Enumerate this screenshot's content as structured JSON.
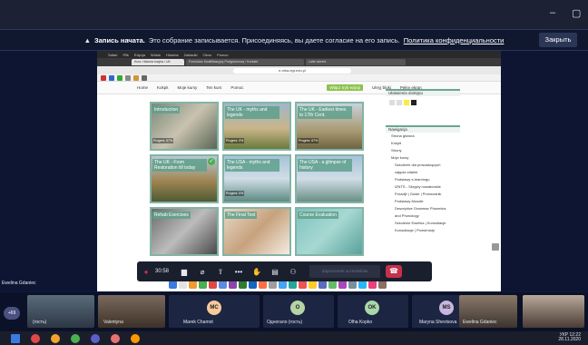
{
  "window": {
    "minimize": "–",
    "maximize": "▢"
  },
  "recording_banner": {
    "title": "Запись начата.",
    "message": "Это собрание записывается. Присоединяясь, вы даете согласие на его запись.",
    "policy_link": "Политика конфиденциальности",
    "close_label": "Закрыть"
  },
  "browser": {
    "app_menu": [
      "Safari",
      "Plik",
      "Edycja",
      "Widok",
      "Historia",
      "Zakładki",
      "Okno",
      "Pomoc"
    ],
    "tabs": [
      "Kurs: Historia krajów / UK",
      "Formularz Kwalifikacyjny Podyplomowy / Kontakt",
      "Latte aiorenl"
    ],
    "address": "e-mka.egt.edu.pl"
  },
  "site_nav": {
    "items": [
      "Home",
      "Kokpit",
      "Moje kursy",
      "Ten kurs",
      "Pomoc"
    ],
    "highlight": "Włącz tryb edycji",
    "other": [
      "Ukryj bloki",
      "Pełny ekran"
    ]
  },
  "tiles": [
    {
      "label": "Introduction",
      "progress": "Progres: 67%"
    },
    {
      "label": "The UK - myths and legends",
      "progress": "Progres: 0%"
    },
    {
      "label": "The UK - Earliest times to 17th Cent.",
      "progress": "Progres: 67%"
    },
    {
      "label": "The UK - From Restoration till today",
      "progress": ""
    },
    {
      "label": "The USA - myths and legends",
      "progress": "Progres: 0%"
    },
    {
      "label": "The USA - a glimpse of history",
      "progress": ""
    },
    {
      "label": "Rehab Exercises",
      "progress": ""
    },
    {
      "label": "The Final Test",
      "progress": ""
    },
    {
      "label": "Course Evaluation",
      "progress": ""
    }
  ],
  "sidebar": {
    "access_header": "Ułatwienia dostępu",
    "nav_header": "Nawigacja",
    "nav_items": [
      "Strona główna",
      "Kokpit",
      "Strony",
      "Moje kursy",
      "Szkolenie dla prowadzących",
      "zajęcia zdalne",
      "Podstawy e-learningu",
      "IZNTS - Skrypty nowatorskie",
      "Poradỹi | Guide | Przewodnik",
      "Podstawy Moodle",
      "Descriptive Grammar Phonetics",
      "and Phonology",
      "Szkolenie Ewelina | Konsultacje",
      "Konsultacje | Przedmioty"
    ]
  },
  "call_controls": {
    "timer": "30:58",
    "join_placeholder": "Zaproszenie uczestników"
  },
  "presenter_name": "Ewelina Gdaniec",
  "participants": {
    "more_count": "+69",
    "people": [
      {
        "name": "(гость)",
        "initials": ""
      },
      {
        "name": "Valentyna",
        "initials": ""
      },
      {
        "name": "Marek Chamot",
        "initials": "MC"
      },
      {
        "name": "Одногало (гость)",
        "initials": "O"
      },
      {
        "name": "Olha Kopko",
        "initials": "OK"
      },
      {
        "name": "Maryna Shevtsova",
        "initials": "MS"
      },
      {
        "name": "Ewelina Gdaniec",
        "initials": ""
      },
      {
        "name": "",
        "initials": ""
      }
    ]
  },
  "tray": {
    "lang": "УКР",
    "time": "12:22",
    "date": "28.11.2020"
  },
  "colors": {
    "accent": "#6aa596",
    "hangup": "#c4314b",
    "mc": "#f7c99b",
    "o": "#b5d4a5",
    "ok": "#a8d8a8",
    "ms": "#c8b6e0"
  }
}
